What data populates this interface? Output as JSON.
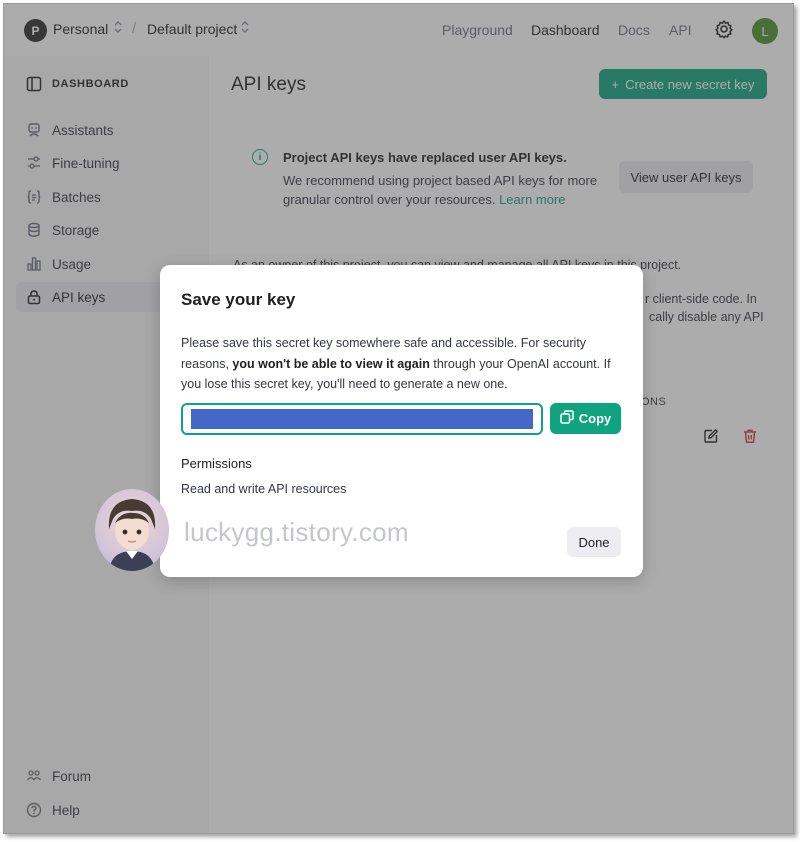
{
  "topbar": {
    "org_initial": "P",
    "org_name": "Personal",
    "separator": "/",
    "project_name": "Default project",
    "nav": [
      "Playground",
      "Dashboard",
      "Docs",
      "API"
    ],
    "active_nav": "Dashboard",
    "user_initial": "L"
  },
  "sidebar": {
    "header": "DASHBOARD",
    "items": [
      {
        "label": "Assistants",
        "icon": "assistant-icon"
      },
      {
        "label": "Fine-tuning",
        "icon": "sliders-icon"
      },
      {
        "label": "Batches",
        "icon": "braces-icon"
      },
      {
        "label": "Storage",
        "icon": "database-icon"
      },
      {
        "label": "Usage",
        "icon": "bar-chart-icon"
      },
      {
        "label": "API keys",
        "icon": "lock-icon"
      }
    ],
    "active_item": "API keys",
    "footer": [
      {
        "label": "Forum",
        "icon": "people-icon"
      },
      {
        "label": "Help",
        "icon": "help-icon"
      }
    ]
  },
  "main": {
    "title": "API keys",
    "create_button": "Create new secret key",
    "notice": {
      "title": "Project API keys have replaced user API keys.",
      "body": "We recommend using project based API keys for more granular control over your resources.",
      "link": "Learn more",
      "button": "View user API keys"
    },
    "owner_text": "As an owner of this project, you can view and manage all API keys in this project.",
    "fragments": [
      "r client-side code. In",
      "cally disable any API",
      "ONS"
    ]
  },
  "modal": {
    "title": "Save your key",
    "desc_1": "Please save this secret key somewhere safe and accessible. For security reasons, ",
    "desc_bold": "you won't be able to view it again",
    "desc_2": " through your OpenAI account. If you lose this secret key, you'll need to generate a new one.",
    "copy_button": "Copy",
    "permissions_label": "Permissions",
    "permissions_value": "Read and write API resources",
    "done_button": "Done"
  },
  "watermark": {
    "text": "luckygg.tistory.com"
  },
  "colors": {
    "accent": "#10a37f",
    "key_redaction": "#4468c8",
    "delete": "#d9363e"
  }
}
